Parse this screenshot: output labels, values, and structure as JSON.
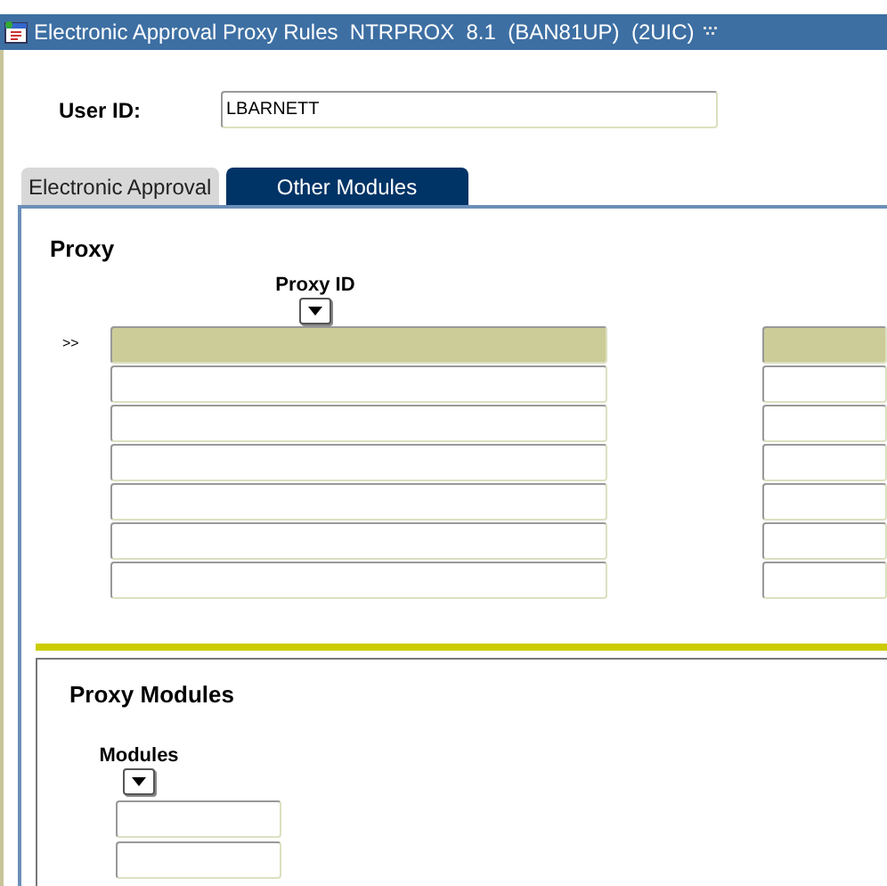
{
  "window": {
    "title": "Electronic Approval Proxy Rules  NTRPROX  8.1  (BAN81UP)  (2UIC)"
  },
  "user_id": {
    "label": "User ID:",
    "value": "LBARNETT"
  },
  "tabs": [
    {
      "label": "Electronic Approval",
      "selected": false
    },
    {
      "label": "Other Modules",
      "selected": true
    }
  ],
  "proxy": {
    "heading": "Proxy",
    "column": "Proxy ID",
    "current_marker": ">>",
    "rows": [
      {
        "selected": true
      },
      {
        "selected": false
      },
      {
        "selected": false
      },
      {
        "selected": false
      },
      {
        "selected": false
      },
      {
        "selected": false
      },
      {
        "selected": false
      }
    ]
  },
  "proxy_modules": {
    "heading": "Proxy Modules",
    "column": "Modules",
    "rows": [
      {
        "selected": false
      },
      {
        "selected": false
      }
    ]
  }
}
